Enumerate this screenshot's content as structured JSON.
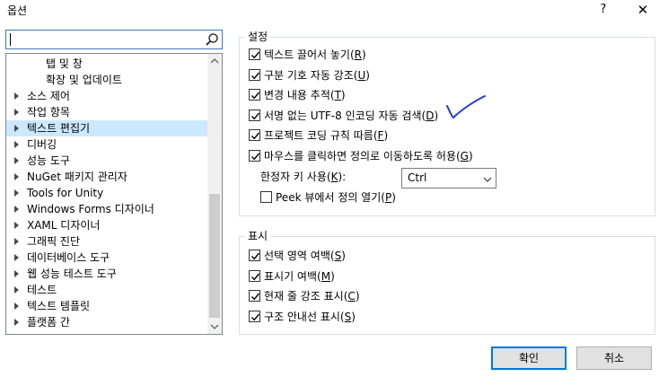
{
  "window": {
    "title": "옵션",
    "help_glyph": "?",
    "close_glyph": "✕"
  },
  "search": {
    "value": "",
    "placeholder": ""
  },
  "tree": {
    "items": [
      {
        "label": "탭 및 창",
        "child": true
      },
      {
        "label": "확장 및 업데이트",
        "child": true
      },
      {
        "label": "소스 제어",
        "child": false
      },
      {
        "label": "작업 항목",
        "child": false
      },
      {
        "label": "텍스트 편집기",
        "child": false,
        "selected": true
      },
      {
        "label": "디버깅",
        "child": false
      },
      {
        "label": "성능 도구",
        "child": false
      },
      {
        "label": "NuGet 패키지 관리자",
        "child": false
      },
      {
        "label": "Tools for Unity",
        "child": false
      },
      {
        "label": "Windows Forms 디자이너",
        "child": false
      },
      {
        "label": "XAML 디자이너",
        "child": false
      },
      {
        "label": "그래픽 진단",
        "child": false
      },
      {
        "label": "데이터베이스 도구",
        "child": false
      },
      {
        "label": "웹 성능 테스트 도구",
        "child": false
      },
      {
        "label": "테스트",
        "child": false
      },
      {
        "label": "텍스트 템플릿",
        "child": false
      },
      {
        "label": "플랫폼 간",
        "child": false
      }
    ]
  },
  "settings": {
    "legend": "설정",
    "options": [
      {
        "text": "텍스트 끌어서 놓기",
        "key": "R",
        "checked": true
      },
      {
        "text": "구분 기호 자동 강조",
        "key": "U",
        "checked": true
      },
      {
        "text": "변경 내용 추적",
        "key": "T",
        "checked": true
      },
      {
        "text": "서명 없는 UTF-8 인코딩 자동 검색",
        "key": "D",
        "checked": true
      },
      {
        "text": "프로젝트 코딩 규칙 따름",
        "key": "F",
        "checked": true
      },
      {
        "text": "마우스를 클릭하면 정의로 이동하도록 허용",
        "key": "G",
        "checked": true
      }
    ],
    "scope_label": "한정자 키 사용",
    "scope_key": "K",
    "scope_value": "Ctrl",
    "peek": {
      "text": "Peek 뷰에서 정의 열기",
      "key": "P",
      "checked": false
    }
  },
  "display": {
    "legend": "표시",
    "options": [
      {
        "text": "선택 영역 여백",
        "key": "S",
        "checked": true
      },
      {
        "text": "표시기 여백",
        "key": "M",
        "checked": true
      },
      {
        "text": "현재 줄 강조 표시",
        "key": "C",
        "checked": true
      },
      {
        "text": "구조 안내선 표시",
        "key": "S",
        "checked": true
      }
    ]
  },
  "buttons": {
    "ok": "확인",
    "cancel": "취소"
  },
  "colors": {
    "accent": "#0078d7",
    "selection": "#cce8ff",
    "annotation": "#1f3fd6"
  }
}
